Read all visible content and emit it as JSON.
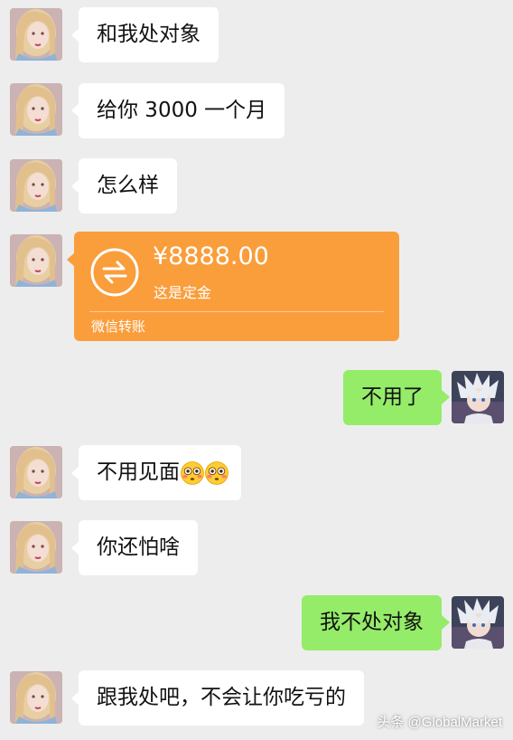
{
  "messages": [
    {
      "side": "left",
      "text": "和我处对象"
    },
    {
      "side": "left",
      "text": "给你 3000 一个月"
    },
    {
      "side": "left",
      "text": "怎么样"
    },
    {
      "side": "left",
      "type": "transfer"
    },
    {
      "side": "right",
      "text": "不用了"
    },
    {
      "side": "left",
      "text": "不用见面"
    },
    {
      "side": "left",
      "text": "你还怕啥"
    },
    {
      "side": "right",
      "text": "我不处对象"
    },
    {
      "side": "left",
      "text": "跟我处吧，不会让你吃亏的"
    }
  ],
  "transfer": {
    "amount": "¥8888.00",
    "note": "这是定金",
    "footer": "微信转账",
    "color": "#fa9d3b"
  },
  "emoji": [
    "flushed-face",
    "flushed-face"
  ],
  "colors": {
    "background": "#ededed",
    "left_bubble": "#ffffff",
    "right_bubble": "#95ec69"
  },
  "watermark": "头条 @GlobalMarket"
}
